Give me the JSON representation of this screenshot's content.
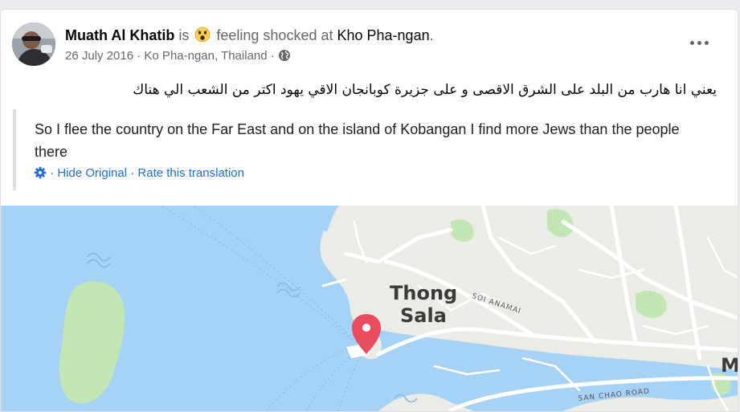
{
  "post": {
    "author": "Muath Al Khatib",
    "is_word": "is",
    "feeling_text": "feeling shocked at",
    "place": "Kho Pha-ngan",
    "period": ".",
    "date": "26 July 2016",
    "separator": "·",
    "location": "Ko Pha-ngan, Thailand",
    "body_arabic": "يعني انا هارب من البلد على الشرق الاقصى و على جزيرة كوبانجان الاقي يهود اكتر من الشعب الي هناك",
    "translation": "So I flee the country on the Far East and on the island of Kobangan I find more Jews than the people there",
    "hide_original": "Hide Original",
    "rate_translation": "Rate this translation",
    "dot": "·"
  },
  "icons": {
    "more": "more-options-icon",
    "feeling": "shocked-emoji-icon",
    "privacy": "globe-icon",
    "settings": "gear-icon",
    "map_pin": "map-pin-icon"
  },
  "map": {
    "labels": {
      "town_line1": "Thong",
      "town_line2": "Sala",
      "road1": "SOI ANAMAI",
      "road2": "SAN CHAO ROAD",
      "edge": "M"
    }
  },
  "colors": {
    "link": "#216fdb",
    "muted": "#65676b",
    "water": "#a6d3f5",
    "land": "#ecece7",
    "park": "#c3e6b5",
    "pin": "#ea4c5f"
  }
}
